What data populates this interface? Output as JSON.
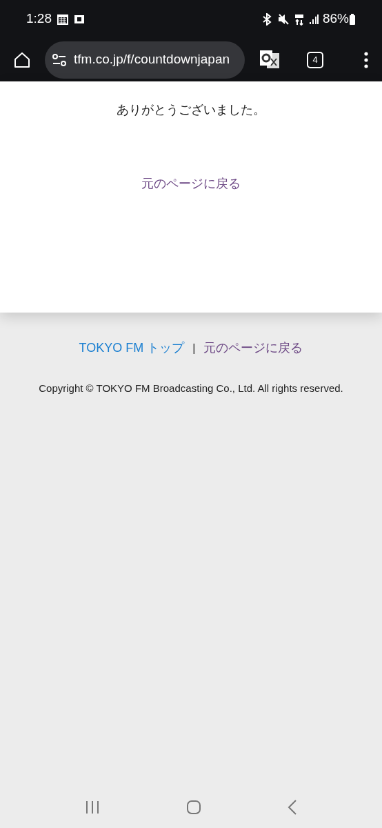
{
  "status_bar": {
    "time": "1:28",
    "battery": "86%"
  },
  "browser": {
    "url": "tfm.co.jp/f/countdownjapan",
    "tab_count": "4"
  },
  "page": {
    "message": "ありがとうございました。",
    "back_link": "元のページに戻る"
  },
  "footer": {
    "links": [
      {
        "label": "TOKYO FM トップ",
        "visited": false
      },
      {
        "label": "元のページに戻る",
        "visited": true
      }
    ],
    "separator": "|",
    "copyright": "Copyright © TOKYO FM Broadcasting Co., Ltd. All rights reserved."
  }
}
